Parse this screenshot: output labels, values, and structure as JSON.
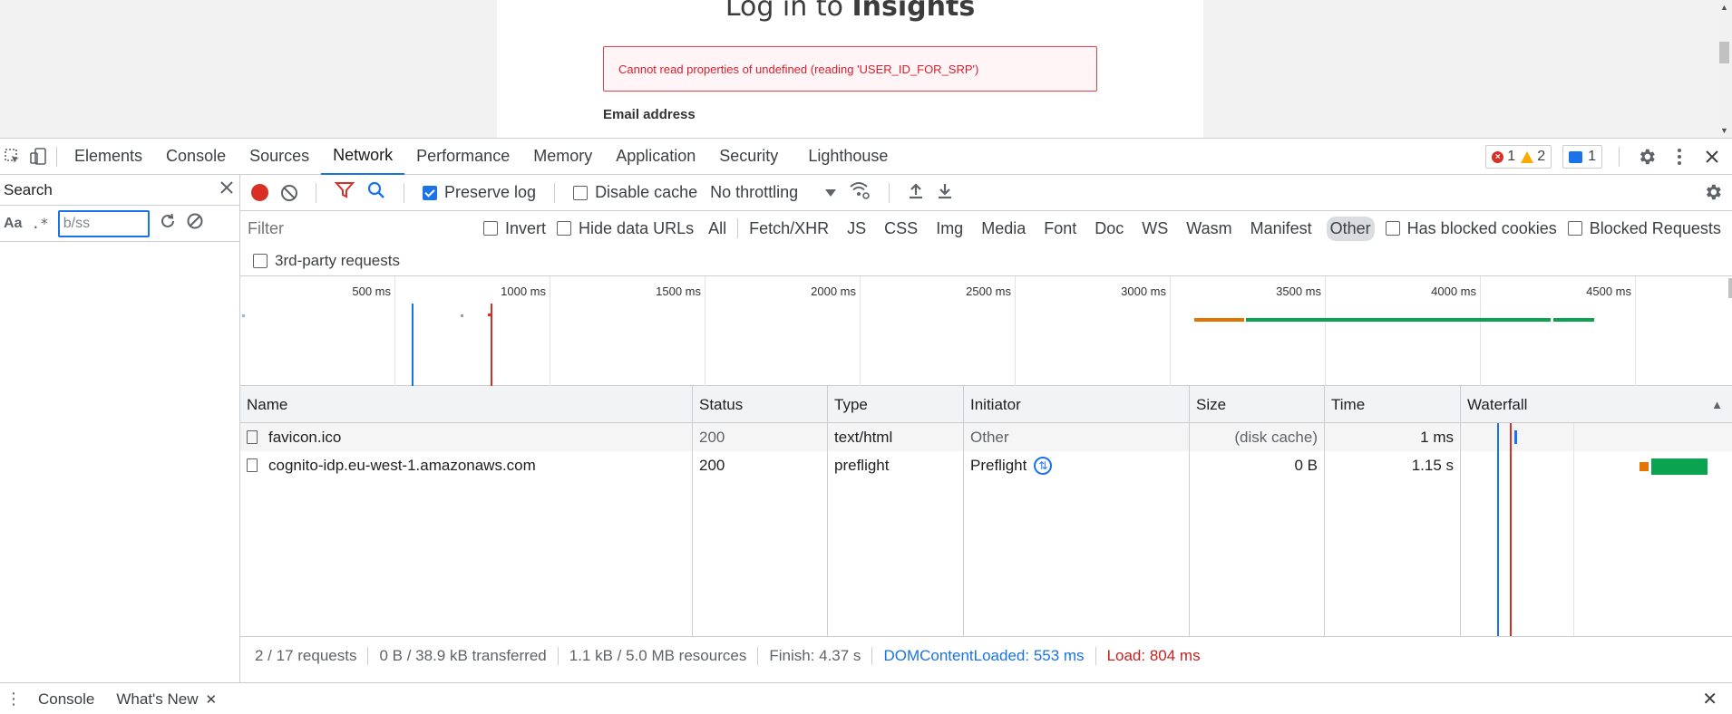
{
  "page": {
    "title_prefix": "Log in to",
    "title_brand": "Insights",
    "error_message": "Cannot read properties of undefined (reading 'USER_ID_FOR_SRP')",
    "email_label": "Email address"
  },
  "devtools": {
    "tabs": [
      "Elements",
      "Console",
      "Sources",
      "Network",
      "Performance",
      "Memory",
      "Application",
      "Security",
      "Lighthouse"
    ],
    "active_tab": "Network",
    "errors_count": "1",
    "warnings_count": "2",
    "messages_count": "1"
  },
  "search": {
    "title": "Search",
    "case_label": "Aa",
    "regex_label": ".*",
    "query": "b/ss"
  },
  "network": {
    "preserve_log": "Preserve log",
    "disable_cache": "Disable cache",
    "throttling": "No throttling",
    "filter_placeholder": "Filter",
    "invert": "Invert",
    "hide_data_urls": "Hide data URLs",
    "types": [
      "All",
      "Fetch/XHR",
      "JS",
      "CSS",
      "Img",
      "Media",
      "Font",
      "Doc",
      "WS",
      "Wasm",
      "Manifest",
      "Other"
    ],
    "active_type": "Other",
    "has_blocked_cookies": "Has blocked cookies",
    "blocked_requests": "Blocked Requests",
    "third_party": "3rd-party requests",
    "overview_ticks": [
      "500 ms",
      "1000 ms",
      "1500 ms",
      "2000 ms",
      "2500 ms",
      "3000 ms",
      "3500 ms",
      "4000 ms",
      "4500 ms"
    ],
    "columns": [
      "Name",
      "Status",
      "Type",
      "Initiator",
      "Size",
      "Time",
      "Waterfall"
    ],
    "rows": [
      {
        "name": "favicon.ico",
        "status": "200",
        "type": "text/html",
        "initiator": "Other",
        "size": "(disk cache)",
        "time": "1 ms"
      },
      {
        "name": "cognito-idp.eu-west-1.amazonaws.com",
        "status": "200",
        "type": "preflight",
        "initiator": "Preflight",
        "size": "0 B",
        "time": "1.15 s"
      }
    ],
    "status": {
      "requests": "2 / 17 requests",
      "transferred": "0 B / 38.9 kB transferred",
      "resources": "1.1 kB / 5.0 MB resources",
      "finish": "Finish: 4.37 s",
      "dcl": "DOMContentLoaded: 553 ms",
      "load": "Load: 804 ms"
    }
  },
  "drawer": {
    "tabs": [
      "Console",
      "What's New"
    ]
  },
  "colors": {
    "accent": "#1a73e8",
    "error": "#d93025",
    "waiting": "#e37400",
    "download": "#0aa34f"
  }
}
